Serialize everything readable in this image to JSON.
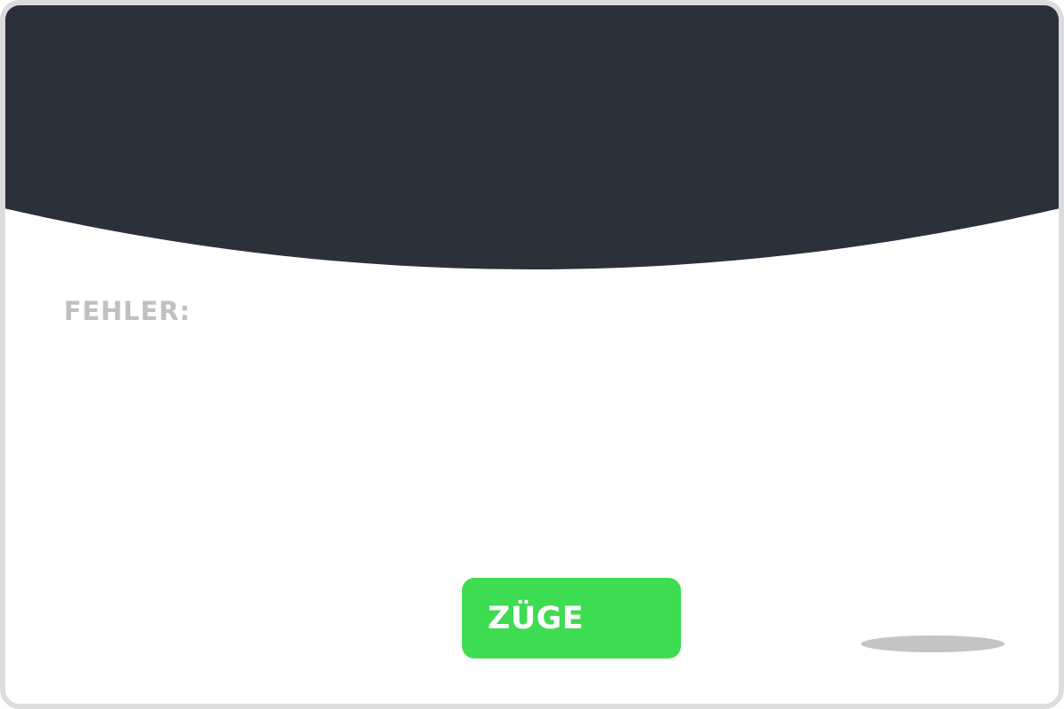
{
  "colors": {
    "header": "#2b313b",
    "frame_border": "#dcdcdc",
    "label_gray": "#c0c0c0",
    "button_green": "#3ddc51",
    "shadow_gray": "#c4c4c4"
  },
  "status": {
    "errors_label": "FEHLER:"
  },
  "actions": {
    "moves_label": "ZÜGE"
  }
}
